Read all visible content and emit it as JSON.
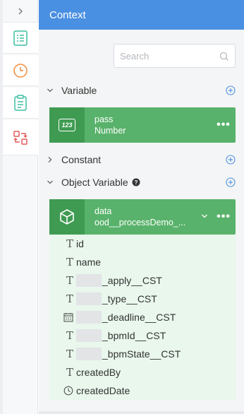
{
  "rail": {
    "collapse_icon": "chevron-right-icon",
    "items": [
      {
        "icon": "list-icon",
        "color": "#3cbfa0"
      },
      {
        "icon": "clock-icon",
        "color": "#f08c3a"
      },
      {
        "icon": "clipboard-icon",
        "color": "#3cbfa0"
      },
      {
        "icon": "convert-icon",
        "color": "#e35b5b"
      }
    ]
  },
  "header": {
    "title": "Context"
  },
  "search": {
    "placeholder": "Search",
    "value": ""
  },
  "sections": {
    "variable": {
      "label": "Variable",
      "expanded": true
    },
    "constant": {
      "label": "Constant",
      "expanded": false
    },
    "object_variable": {
      "label": "Object Variable",
      "expanded": true
    }
  },
  "variable_card": {
    "name": "pass",
    "type": "Number",
    "badge": "123",
    "more": "•••"
  },
  "object_card": {
    "name": "data",
    "type": "ood__processDemo_...",
    "more": "•••"
  },
  "fields": [
    {
      "icon": "text-type-icon",
      "prefix": "",
      "masked": false,
      "label": "id"
    },
    {
      "icon": "text-type-icon",
      "prefix": "",
      "masked": false,
      "label": "name"
    },
    {
      "icon": "text-type-icon",
      "prefix": "",
      "masked": true,
      "label": "_apply__CST"
    },
    {
      "icon": "text-type-icon",
      "prefix": "",
      "masked": true,
      "label": "_type__CST"
    },
    {
      "icon": "calendar-icon",
      "prefix": "",
      "masked": true,
      "label": "_deadline__CST"
    },
    {
      "icon": "text-type-icon",
      "prefix": "",
      "masked": true,
      "label": "_bpmId__CST"
    },
    {
      "icon": "text-type-icon",
      "prefix": "",
      "masked": true,
      "label": "_bpmState__CST"
    },
    {
      "icon": "text-type-icon",
      "prefix": "",
      "masked": false,
      "label": "createdBy"
    },
    {
      "icon": "clock-icon",
      "prefix": "",
      "masked": false,
      "label": "createdDate"
    }
  ],
  "colors": {
    "header": "#4a90e2",
    "card": "#59b26b",
    "card_icon_bg": "#3f9b52",
    "fields_bg": "#e9f7ec",
    "add_icon": "#4a90e2"
  }
}
